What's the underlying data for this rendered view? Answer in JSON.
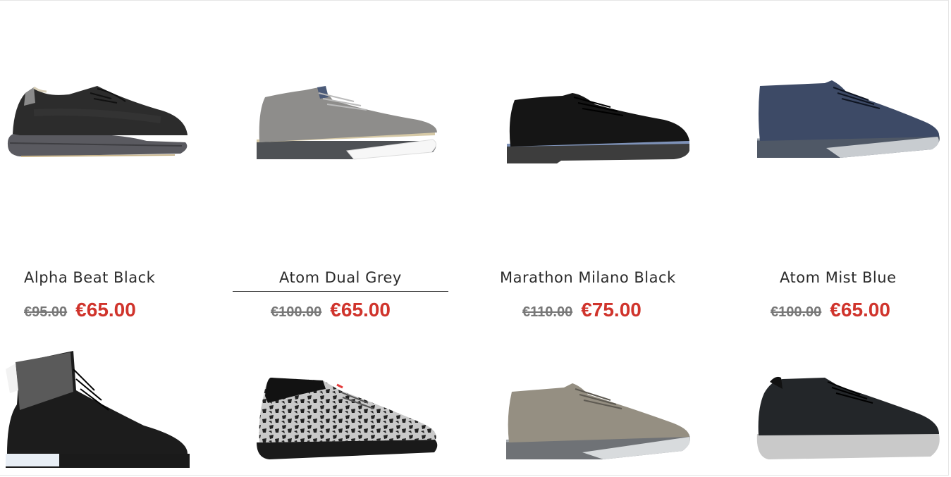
{
  "products_row1": [
    {
      "name": "Alpha Beat Black",
      "old_price": "€95.00",
      "price": "€65.00",
      "image": "black-knit-sneaker"
    },
    {
      "name": "Atom Dual Grey",
      "old_price": "€100.00",
      "price": "€65.00",
      "image": "grey-oxford-sneaker"
    },
    {
      "name": "Marathon Milano Black",
      "old_price": "€110.00",
      "price": "€75.00",
      "image": "black-suede-derby"
    },
    {
      "name": "Atom Mist Blue",
      "old_price": "€100.00",
      "price": "€65.00",
      "image": "navy-mid-sneaker"
    }
  ],
  "products_row2": [
    {
      "image": "black-high-top-boot"
    },
    {
      "image": "leopard-print-sneaker"
    },
    {
      "image": "taupe-mid-sneaker"
    },
    {
      "image": "black-runner-sneaker"
    }
  ],
  "colors": {
    "sale_price": "#d0342c",
    "old_price": "#777777",
    "title": "#2b2b2b"
  }
}
